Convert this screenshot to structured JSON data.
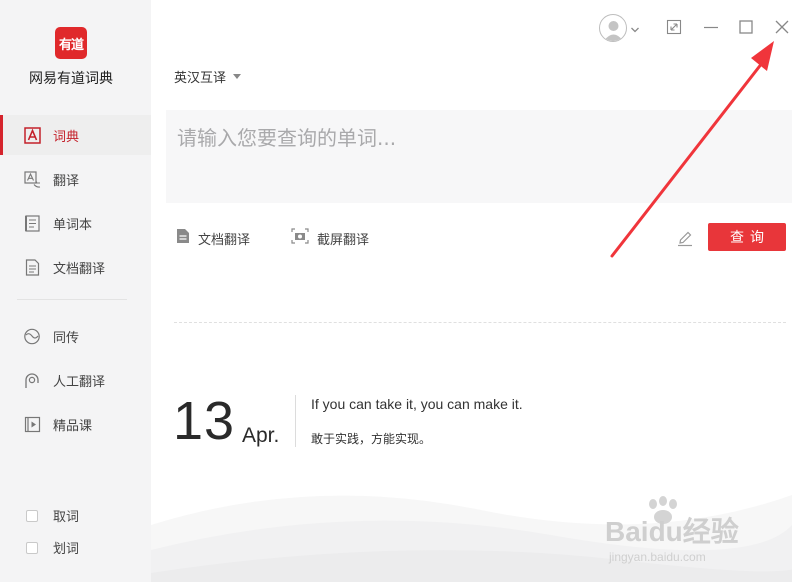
{
  "app": {
    "logo_text": "有道",
    "name": "网易有道词典",
    "brand_color": "#e0292b"
  },
  "sidebar": {
    "items": [
      {
        "label": "词典",
        "icon": "dictionary-icon",
        "active": true
      },
      {
        "label": "翻译",
        "icon": "translate-icon",
        "active": false
      },
      {
        "label": "单词本",
        "icon": "wordbook-icon",
        "active": false
      },
      {
        "label": "文档翻译",
        "icon": "document-translate-icon",
        "active": false
      },
      {
        "label": "同传",
        "icon": "simultaneous-icon",
        "active": false
      },
      {
        "label": "人工翻译",
        "icon": "human-translate-icon",
        "active": false
      },
      {
        "label": "精品课",
        "icon": "course-icon",
        "active": false
      }
    ],
    "checks": [
      {
        "label": "取词",
        "checked": false
      },
      {
        "label": "划词",
        "checked": false
      }
    ]
  },
  "titlebar": {
    "icons": [
      "avatar-icon",
      "chevron-down-icon",
      "shrink-icon",
      "minimize-icon",
      "maximize-icon",
      "close-icon"
    ]
  },
  "main": {
    "mode": "英汉互译",
    "search_placeholder": "请输入您要查询的单词...",
    "tools": [
      {
        "label": "文档翻译",
        "icon": "document-icon"
      },
      {
        "label": "截屏翻译",
        "icon": "screenshot-icon"
      }
    ],
    "query_button": "查询",
    "accent_color": "#e8363a"
  },
  "daily": {
    "day": "13",
    "month": "Apr.",
    "quote_en": "If you can take it, you can make it.",
    "quote_cn": "敢于实践，方能实现。"
  },
  "watermark": {
    "title": "Baidu经验",
    "url": "jingyan.baidu.com"
  },
  "annotation": {
    "arrow_color": "#f0353b"
  }
}
